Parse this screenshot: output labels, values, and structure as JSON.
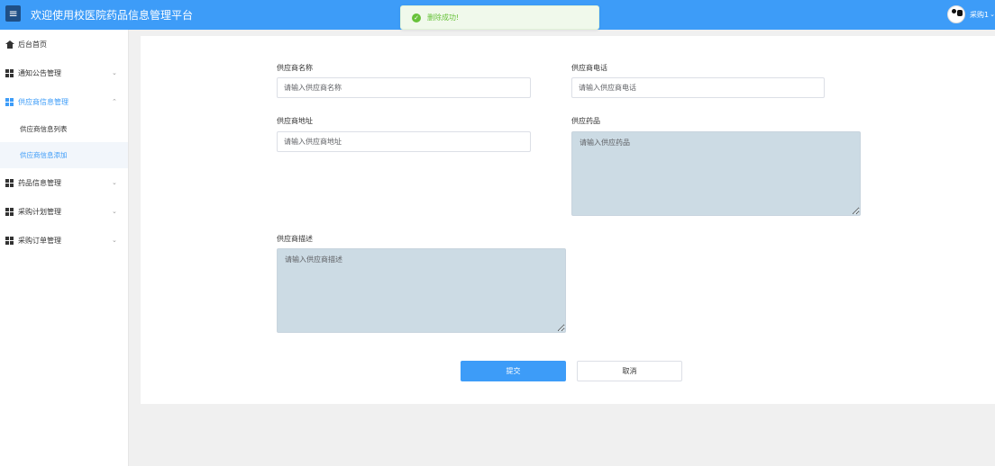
{
  "header": {
    "menu_icon": "hamburger-icon",
    "title": "欢迎使用校医院药品信息管理平台",
    "username": "采购1",
    "accent_color": "#3d9cf8"
  },
  "toast": {
    "icon": "check-circle-icon",
    "message": "删除成功!",
    "color": "#67c23a"
  },
  "sidebar": {
    "items": [
      {
        "label": "后台首页",
        "icon": "home-icon"
      },
      {
        "label": "通知公告管理",
        "icon": "grid-icon",
        "chevron": "⌄"
      },
      {
        "label": "供应商信息管理",
        "icon": "grid-icon",
        "chevron": "⌃"
      },
      {
        "label": "药品信息管理",
        "icon": "grid-icon",
        "chevron": "⌄"
      },
      {
        "label": "采购计划管理",
        "icon": "grid-icon",
        "chevron": "⌄"
      },
      {
        "label": "采购订单管理",
        "icon": "grid-icon",
        "chevron": "⌄"
      }
    ],
    "subitems": [
      {
        "label": "供应商信息列表"
      },
      {
        "label": "供应商信息添加"
      }
    ]
  },
  "form": {
    "name": {
      "label": "供应商名称",
      "placeholder": "请输入供应商名称"
    },
    "phone": {
      "label": "供应商电话",
      "placeholder": "请输入供应商电话"
    },
    "address": {
      "label": "供应商地址",
      "placeholder": "请输入供应商地址"
    },
    "drugs": {
      "label": "供应药品",
      "placeholder": "请输入供应药品"
    },
    "description": {
      "label": "供应商描述",
      "placeholder": "请输入供应商描述"
    },
    "submit_label": "提交",
    "cancel_label": "取消"
  }
}
